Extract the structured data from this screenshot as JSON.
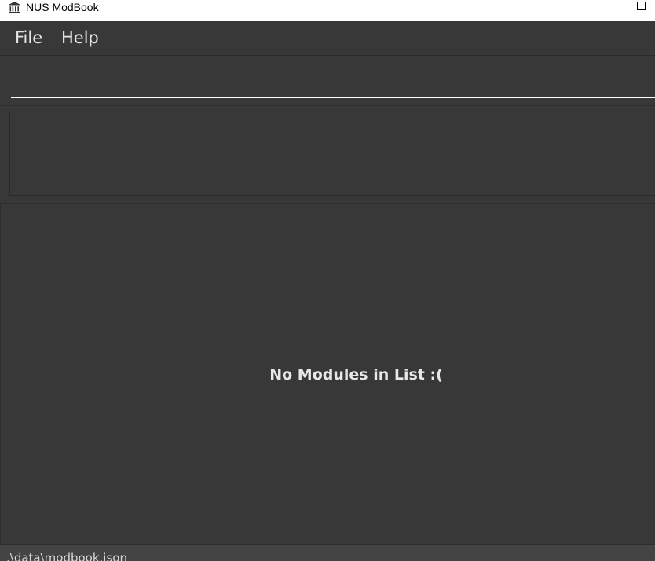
{
  "window": {
    "title": "NUS ModBook",
    "icon": "institution-icon"
  },
  "menu": {
    "file_label": "File",
    "help_label": "Help"
  },
  "command_box": {
    "value": "",
    "placeholder": ""
  },
  "result_display": {
    "text": ""
  },
  "module_list": {
    "empty_message": "No Modules in List :("
  },
  "status_bar": {
    "save_location": ".\\data\\modbook.json"
  },
  "colors": {
    "background": "#383838",
    "titlebar": "#ffffff",
    "text": "#e8e8e8",
    "input_underline": "#ffffff",
    "statusbar": "#444444"
  }
}
